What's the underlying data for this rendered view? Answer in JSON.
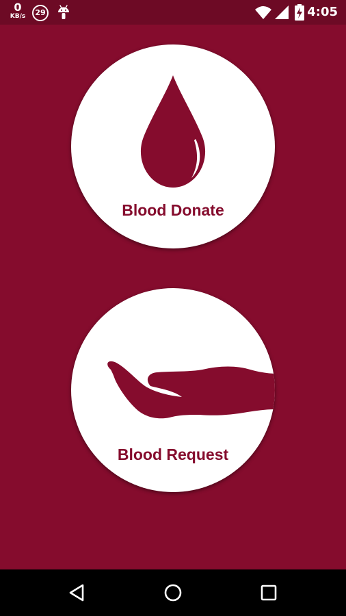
{
  "status_bar": {
    "network_speed_value": "0",
    "network_speed_unit": "KB/s",
    "notification_count": "29",
    "time": "4:05",
    "icons": [
      "android-icon",
      "wifi-icon",
      "cell-signal-icon",
      "battery-charging-icon"
    ]
  },
  "actions": {
    "donate": {
      "label": "Blood Donate",
      "icon": "blood-drop-icon"
    },
    "request": {
      "label": "Blood Request",
      "icon": "open-hand-icon"
    }
  },
  "nav_bar": {
    "icons": [
      "back-icon",
      "home-icon",
      "recents-icon"
    ]
  },
  "colors": {
    "background": "#850c2d",
    "status_bar": "#6d0a25",
    "circle": "#ffffff",
    "accent": "#850c2d",
    "nav_bar": "#000000"
  }
}
